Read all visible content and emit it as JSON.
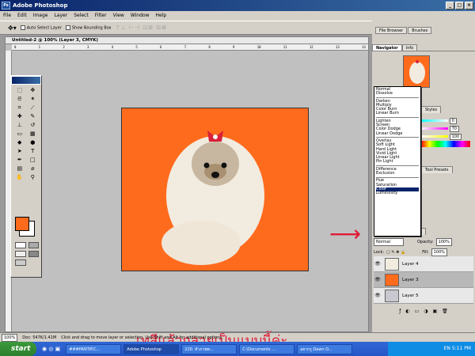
{
  "window": {
    "title": "Adobe Photoshop",
    "logo": "Ps",
    "controls": [
      "_",
      "□",
      "×"
    ]
  },
  "menu": [
    "File",
    "Edit",
    "Image",
    "Layer",
    "Select",
    "Filter",
    "View",
    "Window",
    "Help"
  ],
  "options": {
    "auto_select": "Auto Select Layer",
    "bounding_box": "Show Bounding Box"
  },
  "palette_tabs": [
    "File Browser",
    "Brushes"
  ],
  "document": {
    "title": "Untitled-2 @ 100% (Layer 3, CMYK)",
    "ruler_ticks": [
      "0",
      "1",
      "2",
      "3",
      "4",
      "5",
      "6",
      "7",
      "8",
      "9",
      "10",
      "11",
      "12",
      "13",
      "14"
    ]
  },
  "canvas_text": "เทสีแล้วกลายเป็นแบบนี้ค่ะ",
  "panels": {
    "nav_tabs": [
      "Navigator",
      "Info"
    ],
    "color_tabs": [
      "Color",
      "Swatches",
      "Styles"
    ],
    "color_values": [
      "70",
      "100"
    ],
    "history_tabs": [
      "History",
      "Actions",
      "Tool Presets"
    ],
    "layers_tabs": [
      "Layers",
      "Channels",
      "Paths"
    ]
  },
  "blend_modes": [
    [
      "Normal",
      "Dissolve"
    ],
    [
      "Darken",
      "Multiply",
      "Color Burn",
      "Linear Burn"
    ],
    [
      "Lighten",
      "Screen",
      "Color Dodge",
      "Linear Dodge"
    ],
    [
      "Overlay",
      "Soft Light",
      "Hard Light",
      "Vivid Light",
      "Linear Light",
      "Pin Light"
    ],
    [
      "Difference",
      "Exclusion"
    ],
    [
      "Hue",
      "Saturation",
      "Color",
      "Luminosity"
    ]
  ],
  "blend_selected": "Color",
  "layer_controls": {
    "mode": "Normal",
    "opacity_label": "Opacity:",
    "opacity": "100%",
    "lock_label": "Lock:",
    "fill_label": "Fill:",
    "fill": "100%"
  },
  "layers": [
    {
      "name": "Layer 4"
    },
    {
      "name": "Layer 3"
    },
    {
      "name": "Layer 5"
    }
  ],
  "status": {
    "zoom": "100%",
    "doc": "Doc: 547K/1.41M",
    "hint": "Click and drag to move layer or selection. Use Shift and Alt for additional options."
  },
  "taskbar": {
    "start": "start",
    "tasks": [
      "###PANTIP.C...",
      "Adobe Photoshop",
      "220. ทำภาพพ...",
      "C:\\Documents ...",
      "อยากรู Dawn O..."
    ],
    "lang": "EN",
    "time": "5:11 PM"
  },
  "colors": {
    "canvas": "#ff6b1d",
    "text": "#e01a36",
    "titlebar": "#0a246a"
  }
}
